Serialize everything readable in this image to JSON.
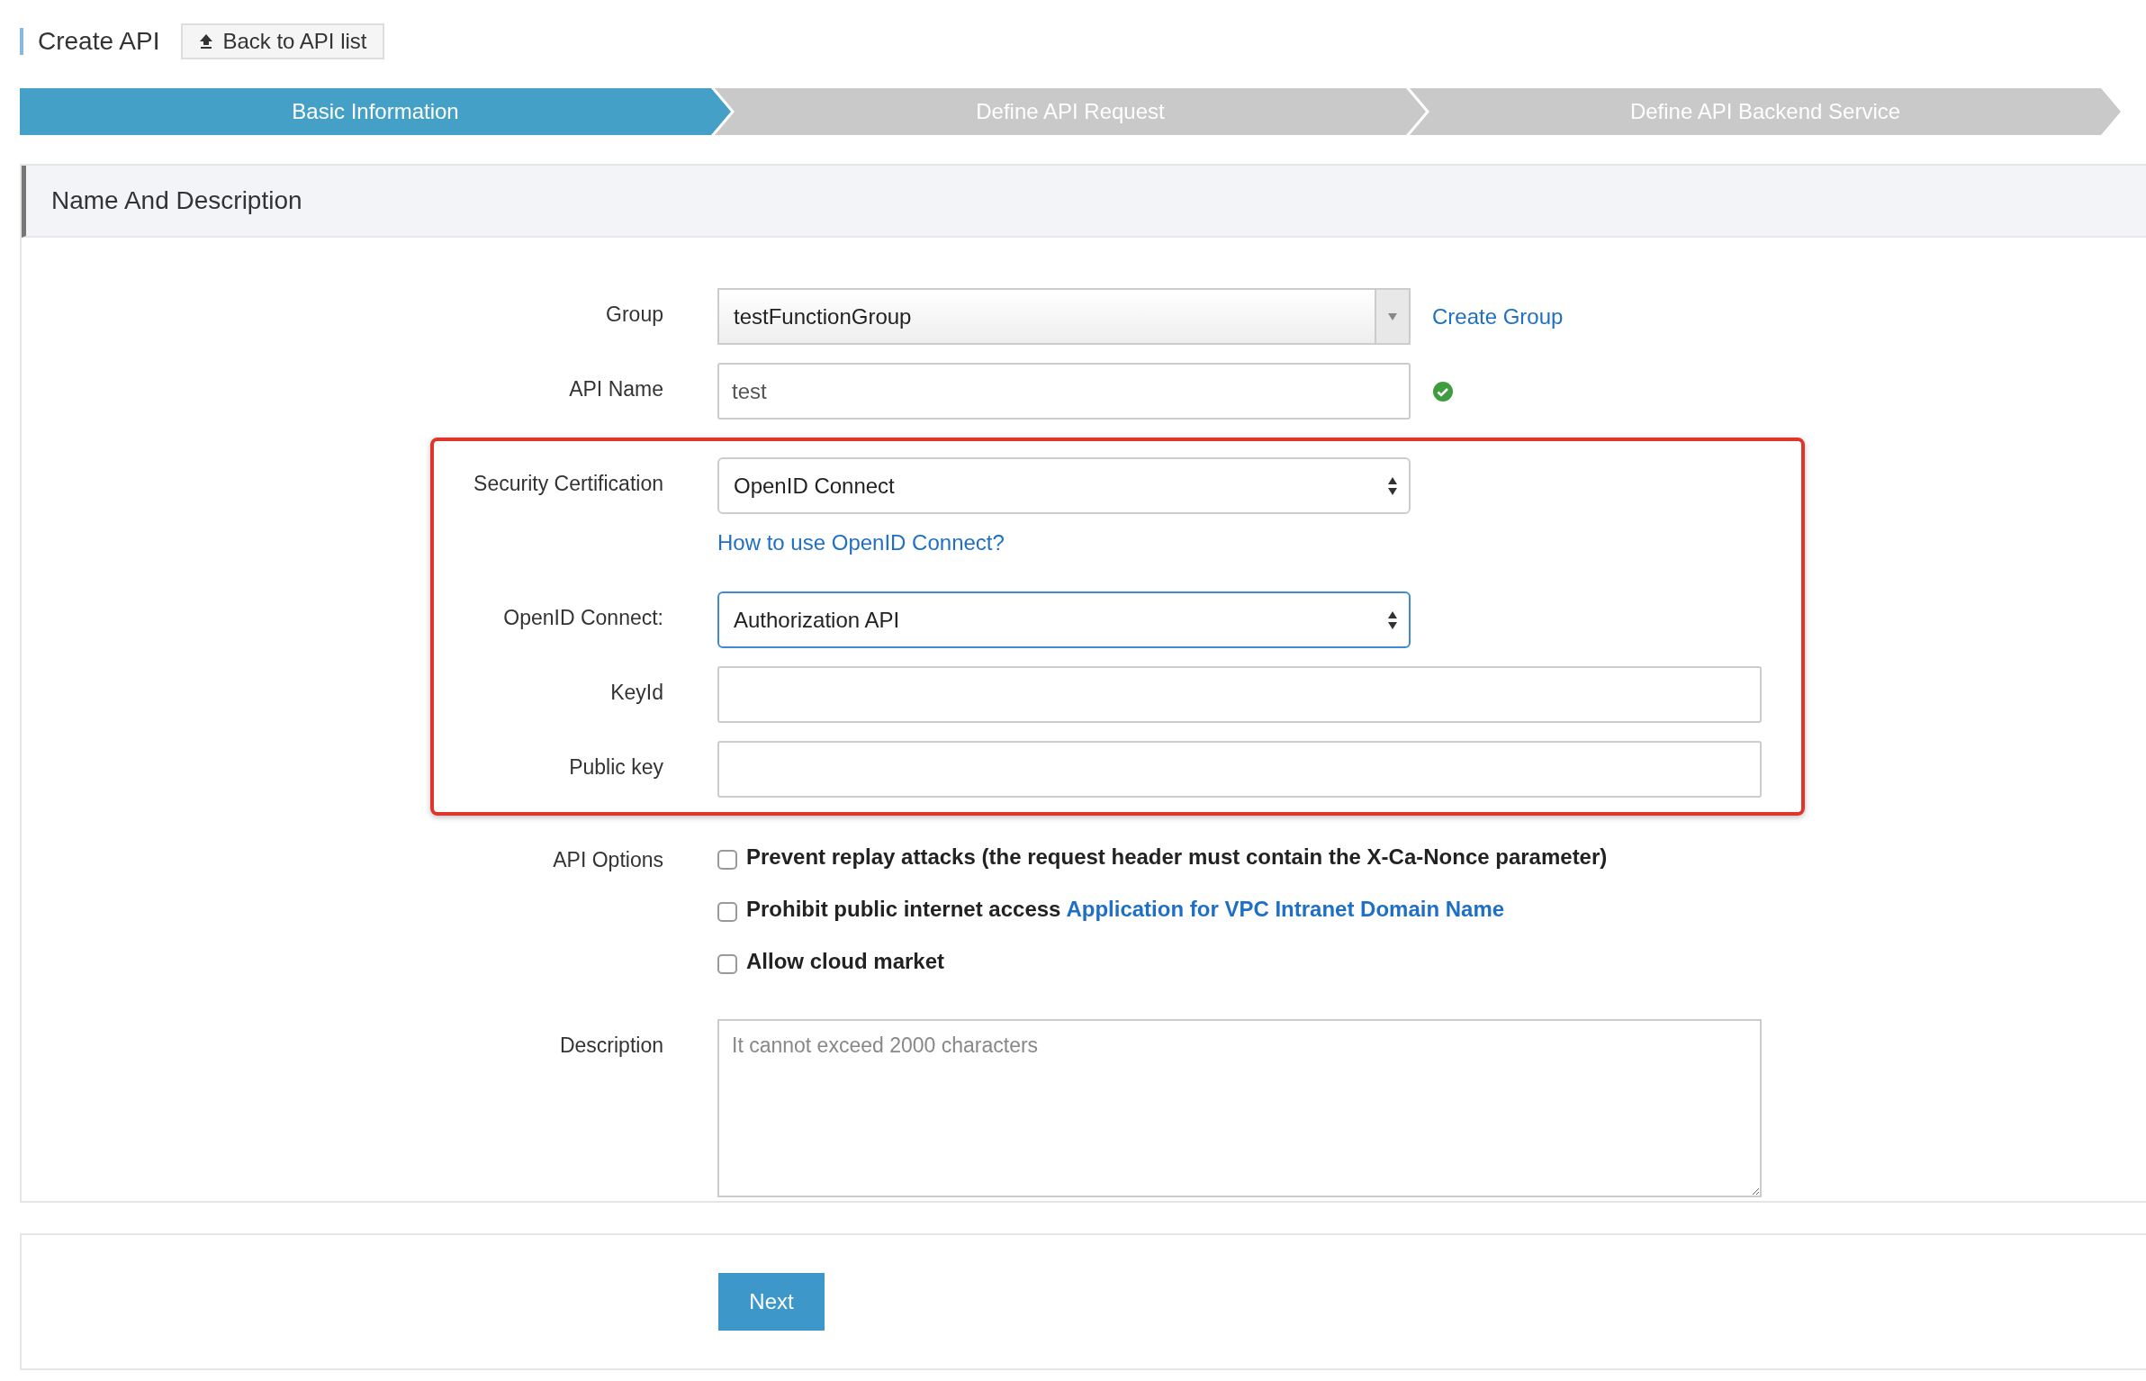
{
  "header": {
    "title": "Create API",
    "back_button": "Back to API list"
  },
  "steps": [
    {
      "label": "Basic Information",
      "selected": true
    },
    {
      "label": "Define API Request",
      "selected": false
    },
    {
      "label": "Define API Backend Service",
      "selected": false
    }
  ],
  "section": {
    "title": "Name And Description",
    "fields": [
      {
        "kind": "combo",
        "label": "Group",
        "value": "testFunctionGroup",
        "link": "Create Group"
      },
      {
        "kind": "input",
        "label": "API Name",
        "value": "test",
        "valid": true,
        "focused": false
      },
      {
        "kind": "highlight",
        "fields": [
          {
            "kind": "select",
            "label": "Security Certification",
            "value": "OpenID Connect",
            "help_link": "How to use OpenID Connect?",
            "focused": false
          },
          {
            "kind": "select",
            "label": "OpenID Connect:",
            "value": "Authorization API",
            "focused": true
          },
          {
            "kind": "wide-input",
            "label": "KeyId",
            "focused": false
          },
          {
            "kind": "wide-input",
            "label": "Public key",
            "focused": false
          }
        ]
      },
      {
        "kind": "options",
        "label": "API Options",
        "options": [
          {
            "text": "Prevent replay attacks (the request header must contain the X-Ca-Nonce parameter)",
            "checked": false
          },
          {
            "text": "Prohibit public internet access",
            "link": "Application for VPC Intranet Domain Name",
            "checked": false
          },
          {
            "text": "Allow cloud market",
            "checked": false
          }
        ]
      },
      {
        "kind": "textarea",
        "label": "Description",
        "placeholder": "It cannot exceed 2000 characters"
      }
    ]
  },
  "footer": {
    "next_button": "Next"
  }
}
